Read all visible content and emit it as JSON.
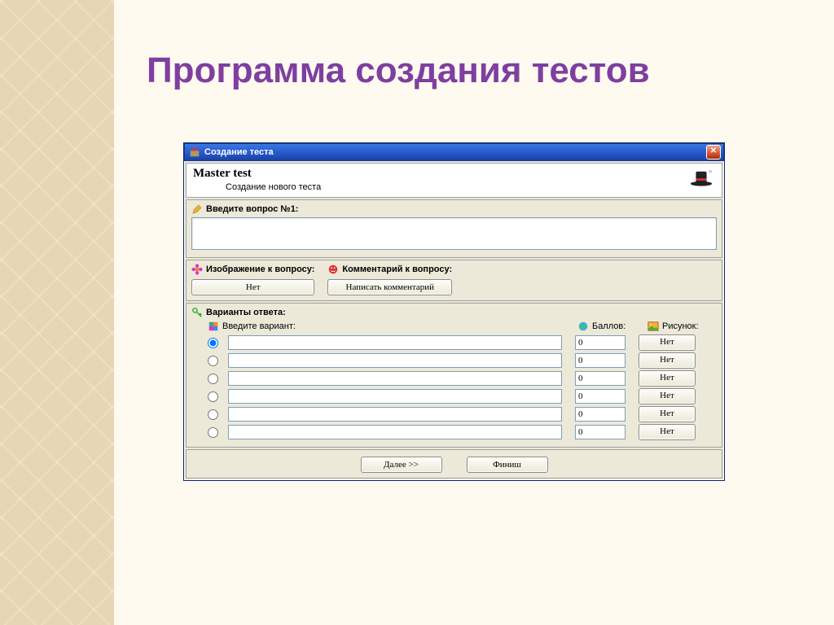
{
  "slide": {
    "title": "Программа создания тестов"
  },
  "window": {
    "title": "Создание теста",
    "header": {
      "title": "Master test",
      "subtitle": "Создание нового теста"
    }
  },
  "question": {
    "label": "Введите вопрос №1:",
    "value": ""
  },
  "image_section": {
    "label": "Изображение к вопросу:",
    "button": "Нет"
  },
  "comment_section": {
    "label": "Комментарий к вопросу:",
    "button": "Написать комментарий"
  },
  "answers": {
    "label": "Варианты ответа:",
    "col_variant": "Введите вариант:",
    "col_points": "Баллов:",
    "col_picture": "Рисунок:",
    "rows": [
      {
        "selected": true,
        "variant": "",
        "points": "0",
        "picture": "Нет"
      },
      {
        "selected": false,
        "variant": "",
        "points": "0",
        "picture": "Нет"
      },
      {
        "selected": false,
        "variant": "",
        "points": "0",
        "picture": "Нет"
      },
      {
        "selected": false,
        "variant": "",
        "points": "0",
        "picture": "Нет"
      },
      {
        "selected": false,
        "variant": "",
        "points": "0",
        "picture": "Нет"
      },
      {
        "selected": false,
        "variant": "",
        "points": "0",
        "picture": "Нет"
      }
    ]
  },
  "footer": {
    "next": "Далее >>",
    "finish": "Финиш"
  }
}
